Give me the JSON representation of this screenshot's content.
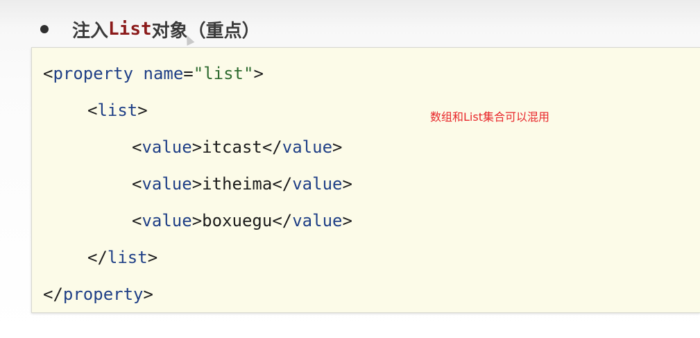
{
  "heading": {
    "prefix": "注入",
    "keyword": "List",
    "suffix": "对象（重点）"
  },
  "code": {
    "line1": {
      "open": "<",
      "tag": "property",
      "attr": "name",
      "eq": "=",
      "value": "\"list\"",
      "close": ">"
    },
    "line2": {
      "open": "<",
      "tag": "list",
      "close": ">"
    },
    "line3": {
      "open": "<",
      "tag": "value",
      "close": ">",
      "text": "itcast",
      "end_open": "</",
      "end_tag": "value",
      "end_close": ">"
    },
    "line4": {
      "open": "<",
      "tag": "value",
      "close": ">",
      "text": "itheima",
      "end_open": "</",
      "end_tag": "value",
      "end_close": ">"
    },
    "line5": {
      "open": "<",
      "tag": "value",
      "close": ">",
      "text": "boxuegu",
      "end_open": "</",
      "end_tag": "value",
      "end_close": ">"
    },
    "line6": {
      "open": "</",
      "tag": "list",
      "close": ">"
    },
    "line7": {
      "open": "</",
      "tag": "property",
      "close": ">"
    }
  },
  "annotation": {
    "text": "数组和List集合可以混用",
    "color": "#e8262a"
  },
  "icons": {
    "bullet": "bullet-icon",
    "cursor": "mouse-cursor-icon"
  }
}
